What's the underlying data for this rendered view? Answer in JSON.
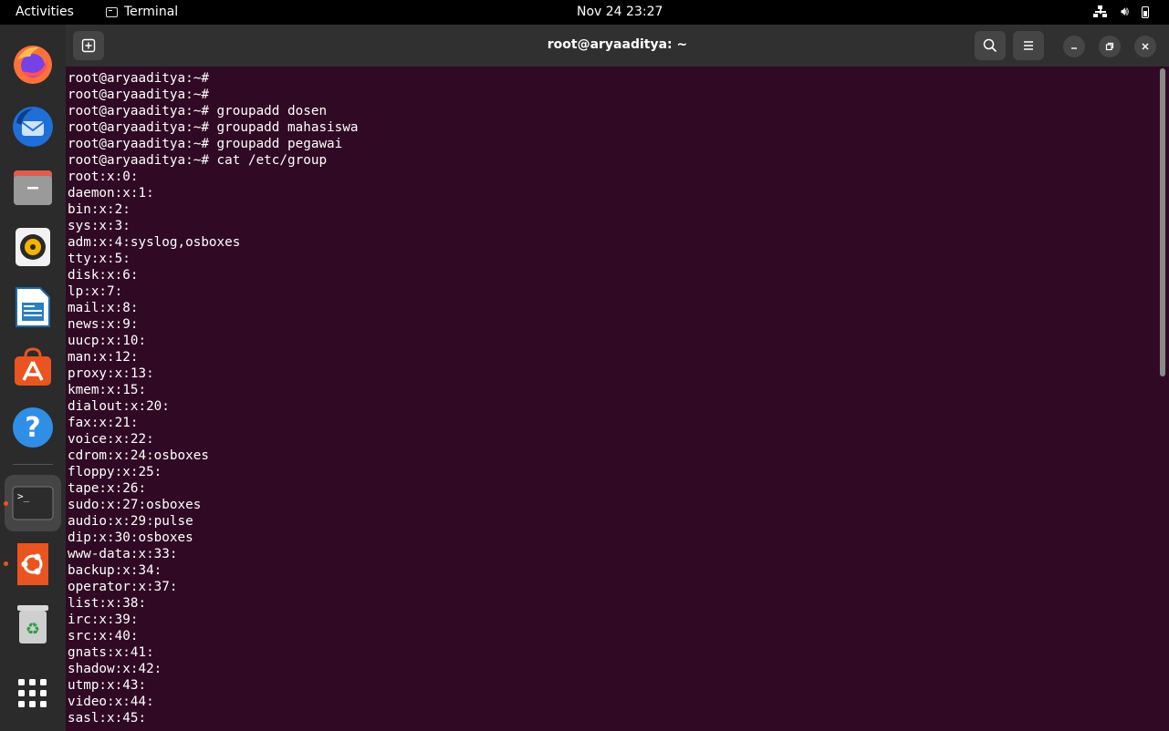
{
  "topbar": {
    "activities": "Activities",
    "app_name": "Terminal",
    "datetime": "Nov 24  23:27"
  },
  "dock": {
    "items": [
      "firefox-icon",
      "thunderbird-icon",
      "files-icon",
      "rhythmbox-icon",
      "libreoffice-writer-icon",
      "app-center-icon",
      "help-icon",
      "terminal-icon",
      "ubuntu-icon",
      "trash-icon",
      "show-apps-icon"
    ]
  },
  "window": {
    "title": "root@aryaaditya: ~"
  },
  "terminal": {
    "lines": [
      "root@aryaaditya:~#",
      "root@aryaaditya:~#",
      "root@aryaaditya:~# groupadd dosen",
      "root@aryaaditya:~# groupadd mahasiswa",
      "root@aryaaditya:~# groupadd pegawai",
      "root@aryaaditya:~# cat /etc/group",
      "root:x:0:",
      "daemon:x:1:",
      "bin:x:2:",
      "sys:x:3:",
      "adm:x:4:syslog,osboxes",
      "tty:x:5:",
      "disk:x:6:",
      "lp:x:7:",
      "mail:x:8:",
      "news:x:9:",
      "uucp:x:10:",
      "man:x:12:",
      "proxy:x:13:",
      "kmem:x:15:",
      "dialout:x:20:",
      "fax:x:21:",
      "voice:x:22:",
      "cdrom:x:24:osboxes",
      "floppy:x:25:",
      "tape:x:26:",
      "sudo:x:27:osboxes",
      "audio:x:29:pulse",
      "dip:x:30:osboxes",
      "www-data:x:33:",
      "backup:x:34:",
      "operator:x:37:",
      "list:x:38:",
      "irc:x:39:",
      "src:x:40:",
      "gnats:x:41:",
      "shadow:x:42:",
      "utmp:x:43:",
      "video:x:44:",
      "sasl:x:45:"
    ]
  }
}
